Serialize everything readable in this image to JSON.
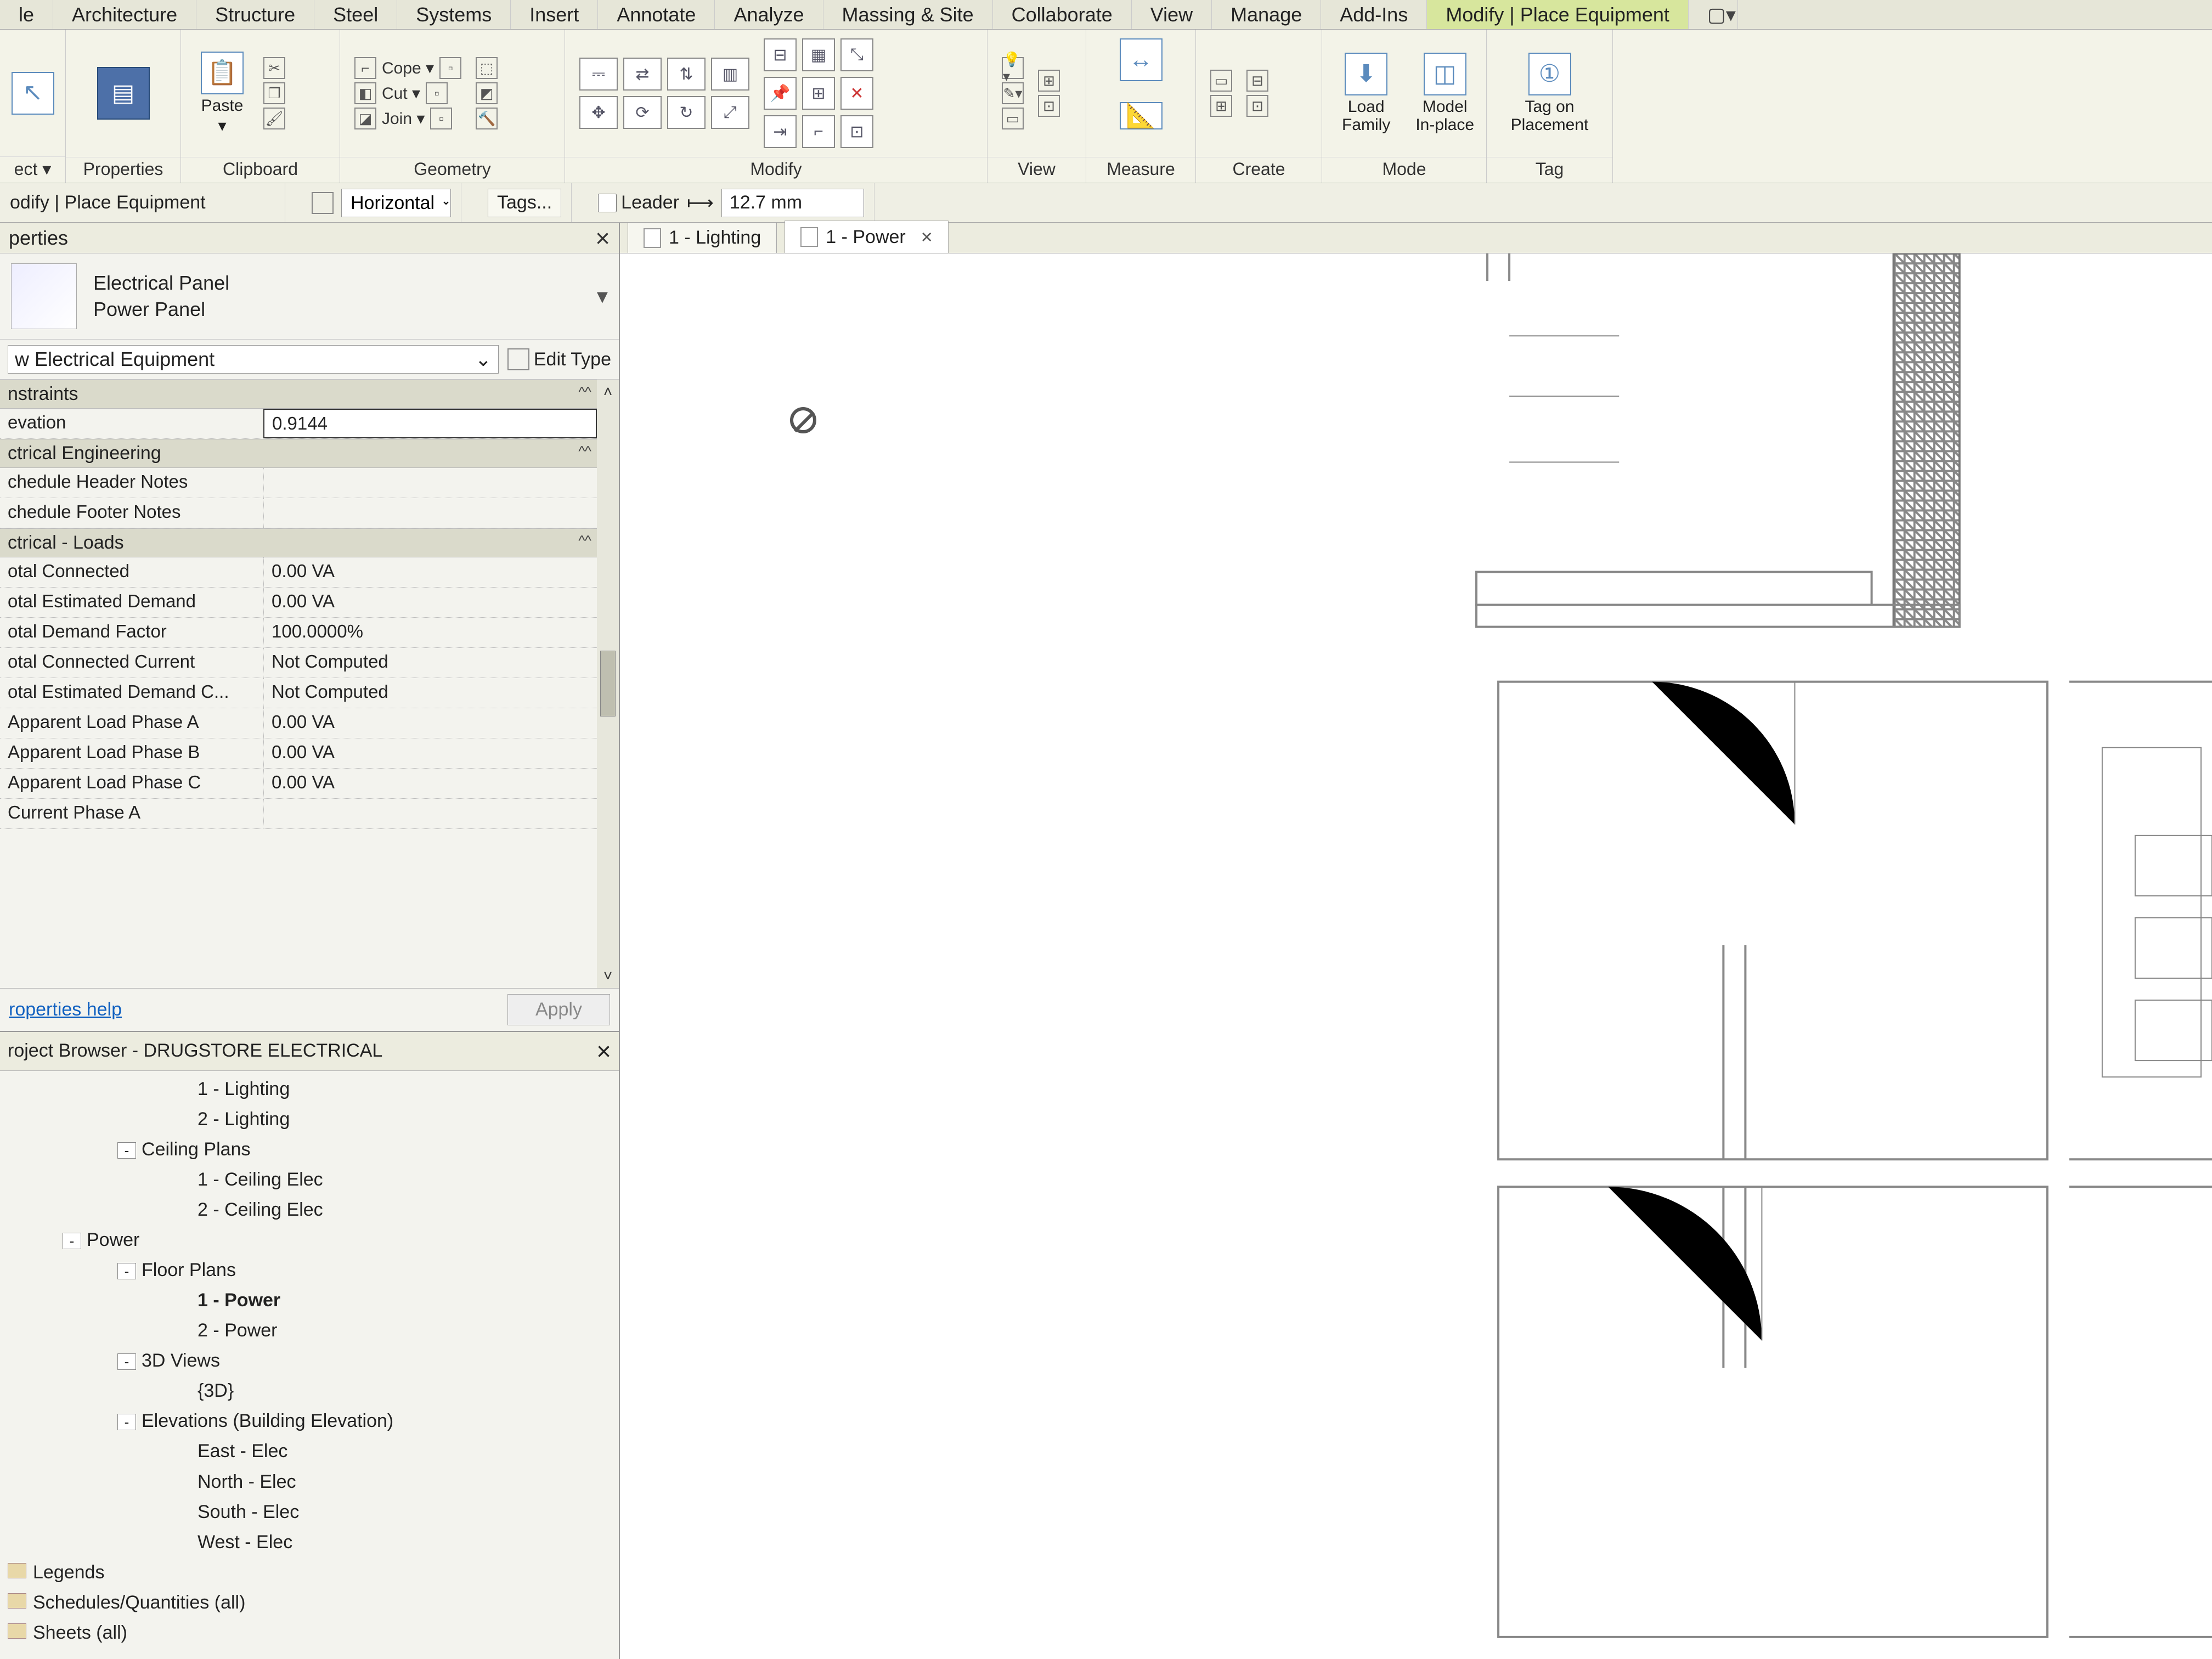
{
  "menubar": {
    "tabs": [
      "le",
      "Architecture",
      "Structure",
      "Steel",
      "Systems",
      "Insert",
      "Annotate",
      "Analyze",
      "Massing & Site",
      "Collaborate",
      "View",
      "Manage",
      "Add-Ins"
    ],
    "active_tab": "Modify | Place Equipment"
  },
  "ribbon": {
    "panels": {
      "select": "ect ▾",
      "properties": "Properties",
      "clipboard": {
        "label": "Clipboard",
        "paste": "Paste"
      },
      "geometry": {
        "label": "Geometry",
        "cope": "Cope ▾",
        "cut": "Cut ▾",
        "join": "Join ▾"
      },
      "modify": "Modify",
      "view": "View",
      "measure": "Measure",
      "create": "Create",
      "mode": {
        "label": "Mode",
        "load_family": "Load\nFamily",
        "model_inplace": "Model\nIn-place"
      },
      "tag": {
        "label": "Tag",
        "tag_on_placement": "Tag on\nPlacement"
      }
    }
  },
  "optionbar": {
    "context": "odify | Place Equipment",
    "orientation": "Horizontal",
    "tags_btn": "Tags...",
    "leader_label": "Leader",
    "leader_checked": false,
    "offset": "12.7 mm"
  },
  "properties": {
    "title": "perties",
    "family": "Electrical Panel",
    "type": "Power Panel",
    "instance_selector": "w Electrical Equipment",
    "edit_type": "Edit Type",
    "help_link": "roperties help",
    "apply": "Apply",
    "groups": [
      {
        "name": "nstraints",
        "rows": [
          {
            "k": "evation",
            "v": "0.9144",
            "editing": true
          }
        ]
      },
      {
        "name": "ctrical Engineering",
        "rows": [
          {
            "k": "chedule Header Notes",
            "v": ""
          },
          {
            "k": "chedule Footer Notes",
            "v": ""
          }
        ]
      },
      {
        "name": "ctrical - Loads",
        "rows": [
          {
            "k": "otal Connected",
            "v": "0.00 VA"
          },
          {
            "k": "otal Estimated Demand",
            "v": "0.00 VA"
          },
          {
            "k": "otal Demand Factor",
            "v": "100.0000%"
          },
          {
            "k": "otal Connected Current",
            "v": "Not Computed"
          },
          {
            "k": "otal Estimated Demand C...",
            "v": "Not Computed"
          },
          {
            "k": "Apparent Load Phase A",
            "v": "0.00 VA"
          },
          {
            "k": "Apparent Load Phase B",
            "v": "0.00 VA"
          },
          {
            "k": "Apparent Load Phase C",
            "v": "0.00 VA"
          },
          {
            "k": "Current Phase A",
            "v": ""
          }
        ]
      }
    ]
  },
  "browser": {
    "title": "roject Browser - DRUGSTORE ELECTRICAL",
    "nodes": [
      {
        "d": 3,
        "t": "1 - Lighting"
      },
      {
        "d": 3,
        "t": "2 - Lighting"
      },
      {
        "d": 2,
        "t": "Ceiling Plans",
        "tw": "-"
      },
      {
        "d": 3,
        "t": "1 - Ceiling Elec"
      },
      {
        "d": 3,
        "t": "2 - Ceiling Elec"
      },
      {
        "d": 1,
        "t": "Power",
        "tw": "-"
      },
      {
        "d": 2,
        "t": "Floor Plans",
        "tw": "-"
      },
      {
        "d": 3,
        "t": "1 - Power",
        "bold": true
      },
      {
        "d": 3,
        "t": "2 - Power"
      },
      {
        "d": 2,
        "t": "3D Views",
        "tw": "-"
      },
      {
        "d": 3,
        "t": "{3D}"
      },
      {
        "d": 2,
        "t": "Elevations (Building Elevation)",
        "tw": "-"
      },
      {
        "d": 3,
        "t": "East - Elec"
      },
      {
        "d": 3,
        "t": "North - Elec"
      },
      {
        "d": 3,
        "t": "South - Elec"
      },
      {
        "d": 3,
        "t": "West - Elec"
      },
      {
        "d": 0,
        "t": "Legends",
        "root": true
      },
      {
        "d": 0,
        "t": "Schedules/Quantities (all)",
        "root": true
      },
      {
        "d": 0,
        "t": "Sheets (all)",
        "root": true
      }
    ]
  },
  "view_tabs": [
    {
      "label": "1 - Lighting",
      "active": false
    },
    {
      "label": "1 - Power",
      "active": true
    }
  ]
}
